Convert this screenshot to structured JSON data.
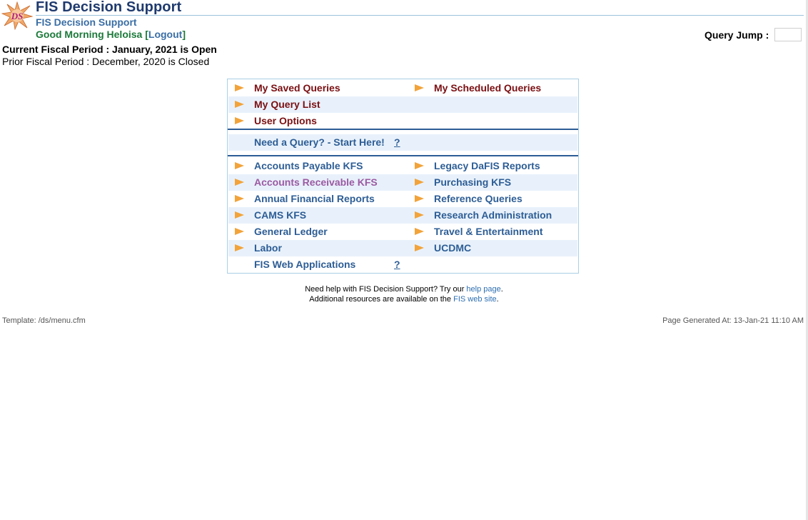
{
  "header": {
    "logo_text": "DS",
    "title": "FIS Decision Support",
    "subtitle": "FIS Decision Support",
    "greeting": "Good Morning Heloisa",
    "logout_open": "[",
    "logout_label": "Logout",
    "logout_close": "]",
    "query_jump_label": "Query Jump :",
    "query_jump_value": ""
  },
  "fiscal": {
    "current": "Current Fiscal Period : January, 2021 is Open",
    "prior": "Prior Fiscal Period : December, 2020 is Closed"
  },
  "menu": {
    "user_links": {
      "saved_queries": "My Saved Queries",
      "scheduled_queries": "My Scheduled Queries",
      "query_list": "My Query List",
      "user_options": "User Options"
    },
    "start_here": "Need a Query? - Start Here!",
    "start_help": "?",
    "categories": {
      "accounts_payable": "Accounts Payable KFS",
      "legacy_dafis": "Legacy DaFIS Reports",
      "accounts_receivable": "Accounts Receivable KFS",
      "purchasing": "Purchasing KFS",
      "annual_financial": "Annual Financial Reports",
      "reference_queries": "Reference Queries",
      "cams": "CAMS KFS",
      "research_admin": "Research Administration",
      "general_ledger": "General Ledger",
      "travel": "Travel & Entertainment",
      "labor": "Labor",
      "ucdmc": "UCDMC"
    },
    "web_apps": "FIS Web Applications",
    "web_apps_help": "?"
  },
  "help": {
    "line1_prefix": "Need help with FIS Decision Support? Try our ",
    "line1_link": "help page",
    "line1_suffix": ".",
    "line2_prefix": "Additional resources are available on the ",
    "line2_link": "FIS web site",
    "line2_suffix": "."
  },
  "footer": {
    "template": "Template: /ds/menu.cfm",
    "generated": "Page Generated At: 13-Jan-21 11:10 AM"
  },
  "colors": {
    "title_blue": "#1f3a6e",
    "link_blue": "#2d5d95",
    "dark_red": "#7a0f12",
    "visited_purple": "#9b5aa2",
    "greeting_green": "#1c7a3a",
    "arrow_orange": "#f2a33a",
    "row_alt": "#e8f1fb"
  }
}
